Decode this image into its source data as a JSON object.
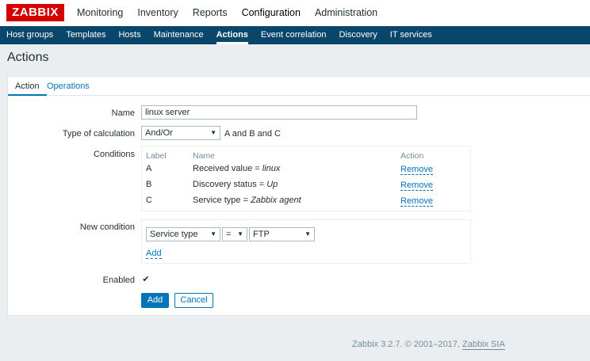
{
  "brand": {
    "logo_text": "ZABBIX",
    "accent": "#d40000",
    "nav_bg": "#0a466a",
    "link": "#0275b8"
  },
  "top_menu": [
    "Monitoring",
    "Inventory",
    "Reports",
    "Configuration",
    "Administration"
  ],
  "sub_menu": [
    "Host groups",
    "Templates",
    "Hosts",
    "Maintenance",
    "Actions",
    "Event correlation",
    "Discovery",
    "IT services"
  ],
  "page": {
    "title": "Actions"
  },
  "tabs": [
    "Action",
    "Operations"
  ],
  "form": {
    "name_label": "Name",
    "name_value": "linux server",
    "calc_label": "Type of calculation",
    "calc_value": "And/Or",
    "calc_formula": "A and B and C",
    "conditions_label": "Conditions",
    "conditions_headers": {
      "label": "Label",
      "name": "Name",
      "action": "Action"
    },
    "conditions": [
      {
        "label": "A",
        "name_prefix": "Received value = ",
        "name_value": "linux",
        "action": "Remove"
      },
      {
        "label": "B",
        "name_prefix": "Discovery status = ",
        "name_value": "Up",
        "action": "Remove"
      },
      {
        "label": "C",
        "name_prefix": "Service type = ",
        "name_value": "Zabbix agent",
        "action": "Remove"
      }
    ],
    "new_condition_label": "New condition",
    "new_condition": {
      "type": "Service type",
      "operator": "=",
      "value": "FTP",
      "add_link": "Add"
    },
    "enabled_label": "Enabled",
    "enabled_check": "✔",
    "add_button": "Add",
    "cancel_button": "Cancel"
  },
  "footer": {
    "text": "Zabbix 3.2.7. © 2001–2017, ",
    "link": "Zabbix SIA"
  }
}
